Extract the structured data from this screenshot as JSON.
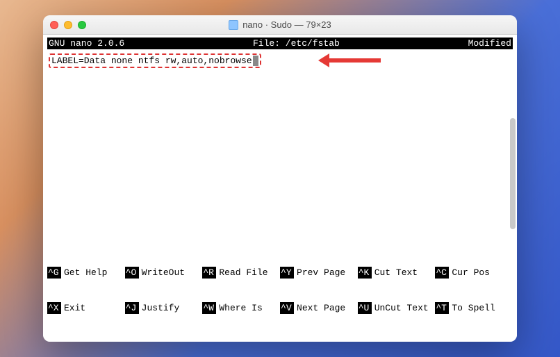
{
  "window": {
    "title": "nano · Sudo — 79×23"
  },
  "header": {
    "app": "GNU nano 2.0.6",
    "file_label": "File: /etc/fstab",
    "status": "Modified"
  },
  "content": {
    "line1": "LABEL=Data none ntfs rw,auto,nobrowse"
  },
  "shortcuts": {
    "row1": [
      {
        "key": "^G",
        "label": "Get Help"
      },
      {
        "key": "^O",
        "label": "WriteOut"
      },
      {
        "key": "^R",
        "label": "Read File"
      },
      {
        "key": "^Y",
        "label": "Prev Page"
      },
      {
        "key": "^K",
        "label": "Cut Text"
      },
      {
        "key": "^C",
        "label": "Cur Pos"
      }
    ],
    "row2": [
      {
        "key": "^X",
        "label": "Exit"
      },
      {
        "key": "^J",
        "label": "Justify"
      },
      {
        "key": "^W",
        "label": "Where Is"
      },
      {
        "key": "^V",
        "label": "Next Page"
      },
      {
        "key": "^U",
        "label": "UnCut Text"
      },
      {
        "key": "^T",
        "label": "To Spell"
      }
    ]
  }
}
